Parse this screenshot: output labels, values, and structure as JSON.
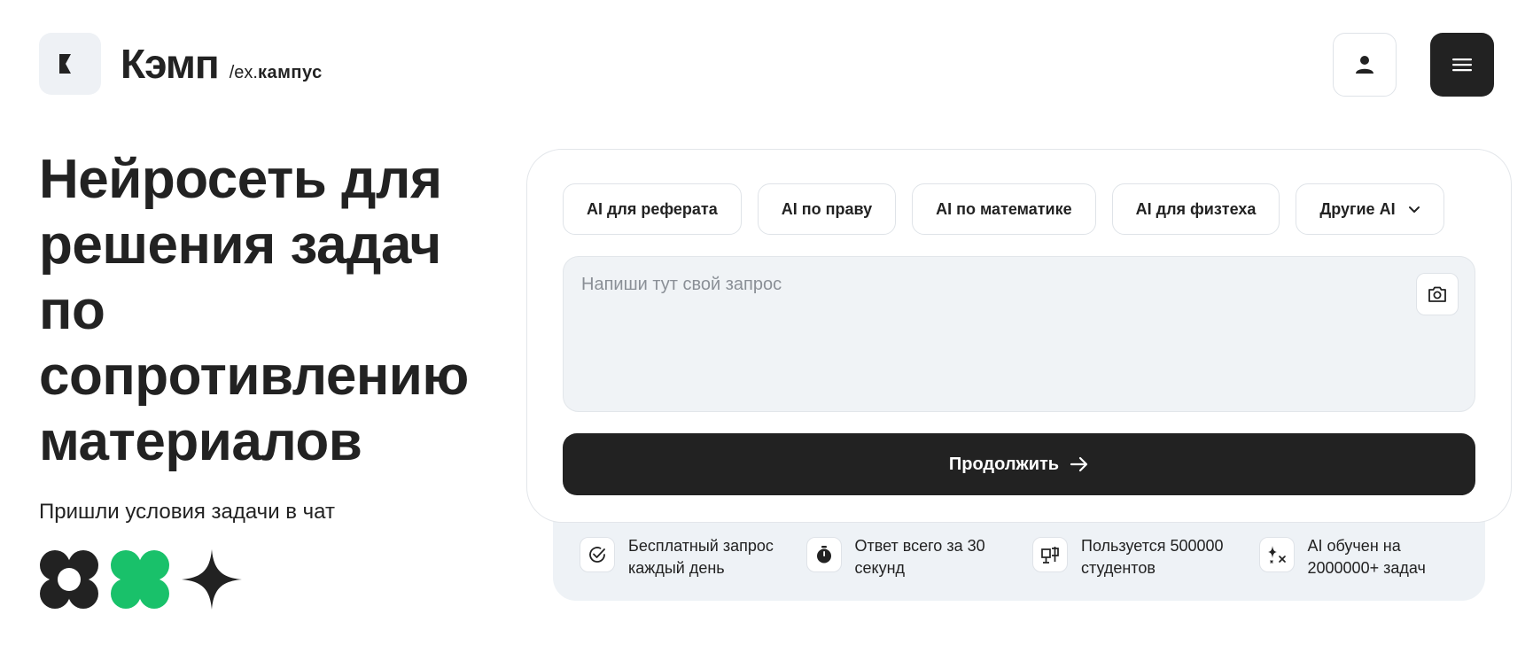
{
  "header": {
    "brand_name": "Кэмп",
    "brand_sub_prefix": "/ex.",
    "brand_sub_name": "кампус"
  },
  "hero": {
    "title": "Нейросеть для решения задач по сопротивлению материалов",
    "subtitle": "Пришли условия задачи в чат"
  },
  "tabs": [
    {
      "label": "AI для реферата"
    },
    {
      "label": "AI по праву"
    },
    {
      "label": "AI по математике"
    },
    {
      "label": "AI для физтеха"
    },
    {
      "label": "Другие AI"
    }
  ],
  "query": {
    "placeholder": "Напиши тут свой запрос",
    "value": ""
  },
  "continue_label": "Продолжить",
  "features": [
    {
      "text": "Бесплатный запрос каждый день",
      "icon": "check-circle-icon"
    },
    {
      "text": "Ответ всего за 30 секунд",
      "icon": "stopwatch-icon"
    },
    {
      "text": "Пользуется 500000 студентов",
      "icon": "users-icon"
    },
    {
      "text": "AI обучен на 2000000+ задач",
      "icon": "sparkles-icon"
    }
  ],
  "colors": {
    "dark": "#222222",
    "accent_green": "#19c16a",
    "panel_bg": "#f0f3f6"
  }
}
